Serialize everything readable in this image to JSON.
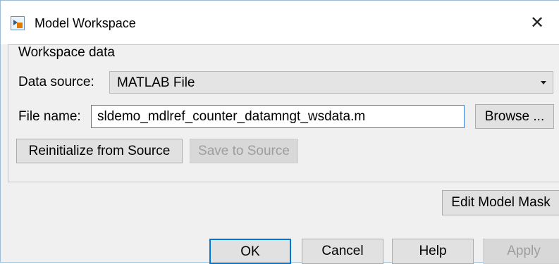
{
  "window": {
    "title": "Model Workspace",
    "close_glyph": "✕"
  },
  "workspace_data": {
    "group_title": "Workspace data",
    "data_source_label": "Data source:",
    "data_source_value": "MATLAB File",
    "file_name_label": "File name:",
    "file_name_value": "sldemo_mdlref_counter_datamngt_wsdata.m",
    "browse_label": "Browse ...",
    "reinitialize_label": "Reinitialize from Source",
    "save_to_source_label": "Save to Source"
  },
  "edit_model_mask_label": "Edit Model Mask",
  "footer": {
    "ok_label": "OK",
    "cancel_label": "Cancel",
    "help_label": "Help",
    "apply_label": "Apply"
  },
  "icons": {
    "app": "simulink-model-icon",
    "close": "close-icon",
    "dropdown": "chevron-down-icon"
  }
}
